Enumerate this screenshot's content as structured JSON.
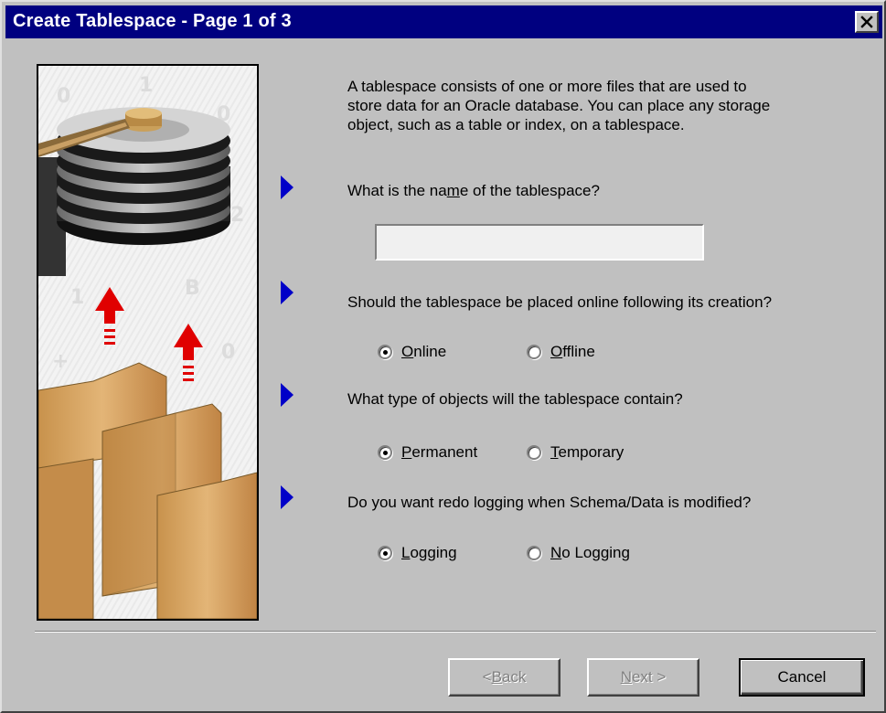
{
  "window": {
    "title": "Create Tablespace - Page 1 of 3",
    "close_glyph": "✕"
  },
  "intro": {
    "text": "A tablespace consists of one or more files that are used to store data for an Oracle database.  You can place any storage object, such as a table or index, on a tablespace."
  },
  "name_question": {
    "prefix": "What is the na",
    "mnemonic": "m",
    "suffix": "e of the tablespace?",
    "value": ""
  },
  "online_question": {
    "text": "Should the tablespace be placed online following its creation?",
    "options": [
      {
        "mnemonic": "O",
        "rest": "nline",
        "checked": true
      },
      {
        "mnemonic": "O",
        "rest": "ffline",
        "checked": false
      }
    ]
  },
  "type_question": {
    "text": "What type of objects will the tablespace contain?",
    "options": [
      {
        "mnemonic": "P",
        "rest": "ermanent",
        "checked": true
      },
      {
        "mnemonic": "T",
        "rest": "emporary",
        "checked": false
      }
    ]
  },
  "logging_question": {
    "text": "Do you want redo logging when Schema/Data is modified?",
    "options": [
      {
        "mnemonic": "L",
        "rest": "ogging",
        "checked": true
      },
      {
        "mnemonic": "N",
        "rest": "o Logging",
        "checked": false
      }
    ]
  },
  "buttons": {
    "back": {
      "prefix": "< ",
      "mnemonic": "B",
      "rest": "ack",
      "enabled": false
    },
    "next": {
      "mnemonic": "N",
      "rest": "ext >",
      "enabled": false
    },
    "cancel": {
      "label": "Cancel",
      "enabled": true
    }
  },
  "icons": {
    "marker": "blue-triangle-arrow-icon",
    "close": "close-icon"
  },
  "colors": {
    "title_bar": "#000080",
    "dialog_bg": "#c0c0c0",
    "marker_blue": "#0000c8",
    "arrow_red": "#e00000",
    "folder_tan": "#d9a862"
  }
}
